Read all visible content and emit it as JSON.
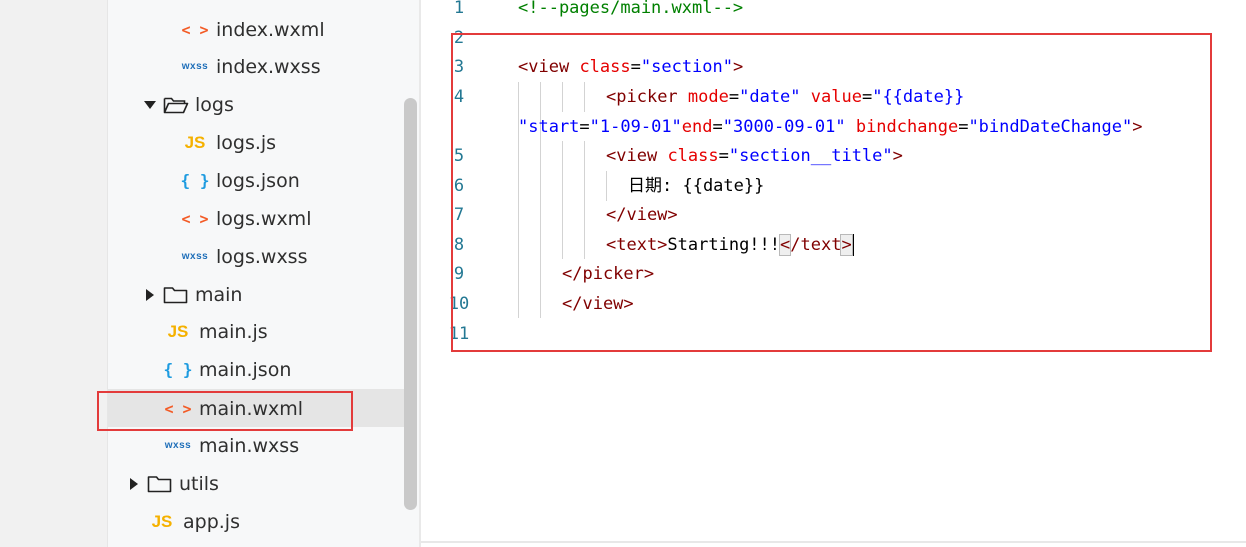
{
  "explorer": {
    "items": [
      {
        "id": "index-wxml",
        "label": "index.wxml",
        "icon": "wxml-icon",
        "glyph": "< >"
      },
      {
        "id": "index-wxss",
        "label": "index.wxss",
        "icon": "wxss-icon",
        "glyph": "wxss"
      },
      {
        "id": "logs-folder",
        "label": "logs",
        "icon": "folder-open-icon",
        "twisty": "expanded"
      },
      {
        "id": "logs-js",
        "label": "logs.js",
        "icon": "js-icon",
        "glyph": "JS"
      },
      {
        "id": "logs-json",
        "label": "logs.json",
        "icon": "json-icon",
        "glyph": "{ }"
      },
      {
        "id": "logs-wxml",
        "label": "logs.wxml",
        "icon": "wxml-icon",
        "glyph": "< >"
      },
      {
        "id": "logs-wxss",
        "label": "logs.wxss",
        "icon": "wxss-icon",
        "glyph": "wxss"
      },
      {
        "id": "main-folder",
        "label": "main",
        "icon": "folder-icon",
        "twisty": "collapsed"
      },
      {
        "id": "main-js",
        "label": "main.js",
        "icon": "js-icon",
        "glyph": "JS"
      },
      {
        "id": "main-json",
        "label": "main.json",
        "icon": "json-icon",
        "glyph": "{ }"
      },
      {
        "id": "main-wxml",
        "label": "main.wxml",
        "icon": "wxml-icon",
        "glyph": "< >",
        "selected": true
      },
      {
        "id": "main-wxss",
        "label": "main.wxss",
        "icon": "wxss-icon",
        "glyph": "wxss"
      },
      {
        "id": "utils-folder",
        "label": "utils",
        "icon": "folder-icon",
        "twisty": "collapsed"
      },
      {
        "id": "app-js",
        "label": "app.js",
        "icon": "js-icon",
        "glyph": "JS"
      }
    ]
  },
  "editor": {
    "line_numbers": [
      "1",
      "2",
      "3",
      "4",
      "",
      "5",
      "6",
      "7",
      "8",
      "9",
      "10",
      "11"
    ],
    "lines": {
      "l1_comment": "<!--pages/main.wxml-->",
      "l3_open": "<",
      "l3_tag": "view",
      "l3_attr": " class",
      "l3_eq": "=",
      "l3_val": "\"section\"",
      "l3_close": ">",
      "l4_open": "<",
      "l4_tag": "picker",
      "l4_attr1": " mode",
      "l4_eq1": "=",
      "l4_val1": "\"date\"",
      "l4_attr2": " value",
      "l4_eq2": "=",
      "l4_val2": "\"{{date}}",
      "l4b_val": "\"start",
      "l4b_eq1": "=",
      "l4b_val1": "\"1-09-01\"",
      "l4b_attr2": "end",
      "l4b_eq2": "=",
      "l4b_val2": "\"3000-09-01\"",
      "l4b_attr3": " bindchange",
      "l4b_eq3": "=",
      "l4b_val3": "\"bindDateChange\"",
      "l4b_close": ">",
      "l5_open": "<",
      "l5_tag": "view",
      "l5_attr": " class",
      "l5_eq": "=",
      "l5_val": "\"section__title\"",
      "l5_close": ">",
      "l6_text": "日期: {{date}}",
      "l7_tag": "</view>",
      "l8_open": "<text>",
      "l8_text": "Starting!!!",
      "l8_close_lt": "<",
      "l8_close_rest": "/text",
      "l8_close_gt": ">",
      "l9_tag": "</picker>",
      "l10_tag": "</view>"
    }
  },
  "colors": {
    "comment": "#008000",
    "tag": "#800000",
    "attribute": "#e50000",
    "value": "#0000ff",
    "line_number": "#237893",
    "highlight_box": "#e33b3b"
  }
}
